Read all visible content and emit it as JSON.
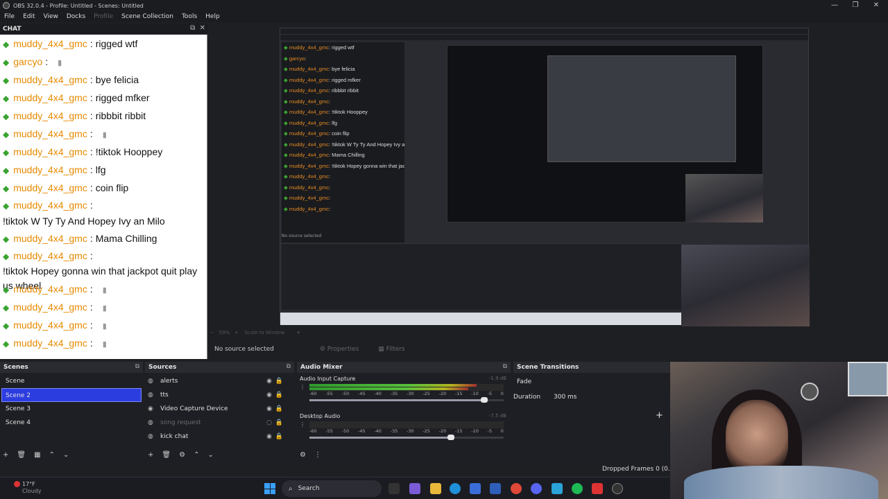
{
  "window": {
    "title": "OBS 32.0.4 - Profile: Untitled - Scenes: Untitled",
    "controls": [
      "—",
      "❐",
      "✕"
    ]
  },
  "menu": [
    "File",
    "Edit",
    "View",
    "Docks",
    "Profile",
    "Scene Collection",
    "Tools",
    "Help"
  ],
  "chat": {
    "title": "CHAT",
    "separator": ":",
    "messages": [
      {
        "user": "muddy_4x4_gmc",
        "text": "rigged wtf"
      },
      {
        "user": "garcyo",
        "text": ""
      },
      {
        "user": "muddy_4x4_gmc",
        "text": "bye felicia"
      },
      {
        "user": "muddy_4x4_gmc",
        "text": "rigged mfker"
      },
      {
        "user": "muddy_4x4_gmc",
        "text": "ribbbit ribbit"
      },
      {
        "user": "muddy_4x4_gmc",
        "text": ""
      },
      {
        "user": "muddy_4x4_gmc",
        "text": "!tiktok Hooppey"
      },
      {
        "user": "muddy_4x4_gmc",
        "text": "lfg"
      },
      {
        "user": "muddy_4x4_gmc",
        "text": "coin flip"
      },
      {
        "user": "muddy_4x4_gmc",
        "text": "!tiktok W Ty Ty And Hopey Ivy an Milo"
      },
      {
        "user": "muddy_4x4_gmc",
        "text": "Mama Chilling"
      },
      {
        "user": "muddy_4x4_gmc",
        "text": "!tiktok Hopey gonna win that jackpot quit play us wheel"
      },
      {
        "user": "muddy_4x4_gmc",
        "text": ""
      },
      {
        "user": "muddy_4x4_gmc",
        "text": ""
      },
      {
        "user": "muddy_4x4_gmc",
        "text": ""
      },
      {
        "user": "muddy_4x4_gmc",
        "text": ""
      }
    ]
  },
  "preview": {
    "controls": "Scale to Window",
    "zoom": "59%",
    "nested_chat": [
      {
        "user": "muddy_4x4_gmc",
        "text": "rigged wtf"
      },
      {
        "user": "garcyo",
        "text": ""
      },
      {
        "user": "muddy_4x4_gmc",
        "text": "bye felicia"
      },
      {
        "user": "muddy_4x4_gmc",
        "text": "rigged mfker"
      },
      {
        "user": "muddy_4x4_gmc",
        "text": "ribbbit ribbit"
      },
      {
        "user": "muddy_4x4_gmc",
        "text": ""
      },
      {
        "user": "muddy_4x4_gmc",
        "text": "!tiktok Hooppey"
      },
      {
        "user": "muddy_4x4_gmc",
        "text": "lfg"
      },
      {
        "user": "muddy_4x4_gmc",
        "text": "coin flip"
      },
      {
        "user": "muddy_4x4_gmc",
        "text": "!tiktok W Ty Ty And Hopey Ivy an Milo"
      },
      {
        "user": "muddy_4x4_gmc",
        "text": "Mama Chilling"
      },
      {
        "user": "muddy_4x4_gmc",
        "text": "!tiktok Hopey gonna win that jackpot quit play us wheel"
      },
      {
        "user": "muddy_4x4_gmc",
        "text": ""
      },
      {
        "user": "muddy_4x4_gmc",
        "text": ""
      },
      {
        "user": "muddy_4x4_gmc",
        "text": ""
      },
      {
        "user": "muddy_4x4_gmc",
        "text": ""
      }
    ],
    "nested_status": "No source selected"
  },
  "source_bar": {
    "no_source": "No source selected",
    "properties": "Properties",
    "filters": "Filters"
  },
  "scenes": {
    "title": "Scenes",
    "items": [
      "Scene",
      "Scene 2",
      "Scene 3",
      "Scene 4"
    ],
    "selected_index": 1
  },
  "sources": {
    "title": "Sources",
    "items": [
      {
        "name": "alerts",
        "visible": true,
        "icon": "browser-icon"
      },
      {
        "name": "tts",
        "visible": true,
        "icon": "browser-icon"
      },
      {
        "name": "Video Capture Device",
        "visible": true,
        "icon": "camera-icon"
      },
      {
        "name": "song request",
        "visible": false,
        "icon": "browser-icon"
      },
      {
        "name": "kick chat",
        "visible": true,
        "icon": "browser-icon"
      }
    ]
  },
  "audio_mixer": {
    "title": "Audio Mixer",
    "tracks": [
      {
        "name": "Audio Input Capture",
        "db": "-1.9 dB",
        "level": 0.86,
        "volume": 0.9
      },
      {
        "name": "Desktop Audio",
        "db": "-7.5 dB",
        "level": 0.0,
        "volume": 0.73
      }
    ],
    "ticks": [
      "-60",
      "-55",
      "-50",
      "-45",
      "-40",
      "-35",
      "-30",
      "-25",
      "-20",
      "-15",
      "-10",
      "-5",
      "0"
    ]
  },
  "transitions": {
    "title": "Scene Transitions",
    "selected": "Fade",
    "duration_label": "Duration",
    "duration_value": "300 ms"
  },
  "status": {
    "dropped_frames": "Dropped Frames 0 (0.0%"
  },
  "taskbar": {
    "temp": "17°F",
    "weather": "Cloudy",
    "search": "Search"
  },
  "colors": {
    "accent": "#2c3de0",
    "chat_user": "#e68a00",
    "chat_badge": "#3aa331"
  }
}
